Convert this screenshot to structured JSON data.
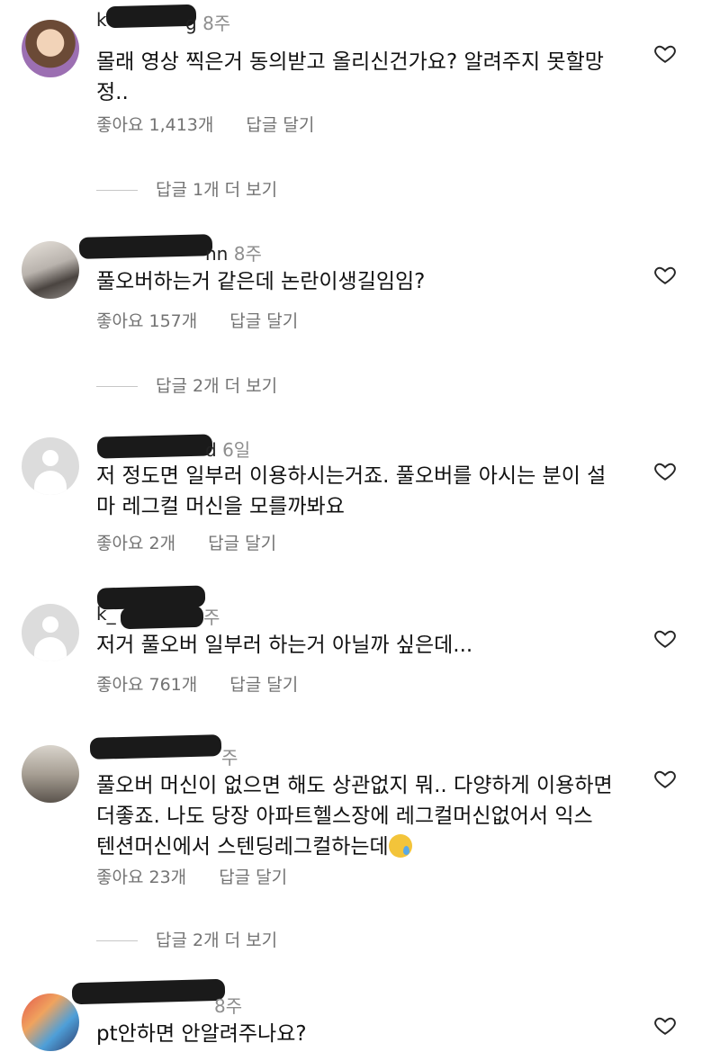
{
  "comments": [
    {
      "username_visible": "k",
      "username_tail": "g",
      "time": "8주",
      "text": "몰래 영상 찍은거 동의받고 올리신건가요? 알려주지 못할망\n정..",
      "likes": "좋아요 1,413개",
      "reply": "답글 달기",
      "more_replies": "답글 1개 더 보기",
      "avatar": "profile-photo"
    },
    {
      "username_visible": "",
      "username_tail": "nn",
      "time": "8주",
      "text": "풀오버하는거 같은데 논란이생길임임?",
      "likes": "좋아요 157개",
      "reply": "답글 달기",
      "more_replies": "답글 2개 더 보기",
      "avatar": "profile-photo"
    },
    {
      "username_visible": "",
      "username_tail": "d",
      "time": "6일",
      "text": "저 정도면 일부러 이용하시는거죠. 풀오버를 아시는 분이 설\n마 레그컬 머신을 모를까봐요",
      "likes": "좋아요 2개",
      "reply": "답글 달기",
      "more_replies": "",
      "avatar": "default-avatar"
    },
    {
      "username_visible": "k_",
      "username_tail": "",
      "time": "주",
      "text": "저거 풀오버 일부러 하는거 아닐까 싶은데...",
      "likes": "좋아요 761개",
      "reply": "답글 달기",
      "more_replies": "",
      "avatar": "default-avatar"
    },
    {
      "username_visible": "",
      "username_tail": "",
      "time": "주",
      "text": "풀오버 머신이 없으면 해도 상관없지 뭐.. 다양하게 이용하면\n더좋죠. 나도 당장  아파트헬스장에  레그컬머신없어서 익스\n텐션머신에서 스텐딩레그컬하는데",
      "likes": "좋아요 23개",
      "reply": "답글 달기",
      "more_replies": "답글 2개 더 보기",
      "avatar": "profile-photo"
    },
    {
      "username_visible": "",
      "username_tail": "",
      "time": "8주",
      "text": "pt안하면 안알려주나요?",
      "likes": "",
      "reply": "",
      "more_replies": "",
      "avatar": "profile-photo"
    }
  ],
  "icons": {
    "like": "heart-icon",
    "reaction": "crying-face-emoji"
  },
  "colors": {
    "text": "#111111",
    "secondary": "#737373",
    "background": "#ffffff"
  }
}
